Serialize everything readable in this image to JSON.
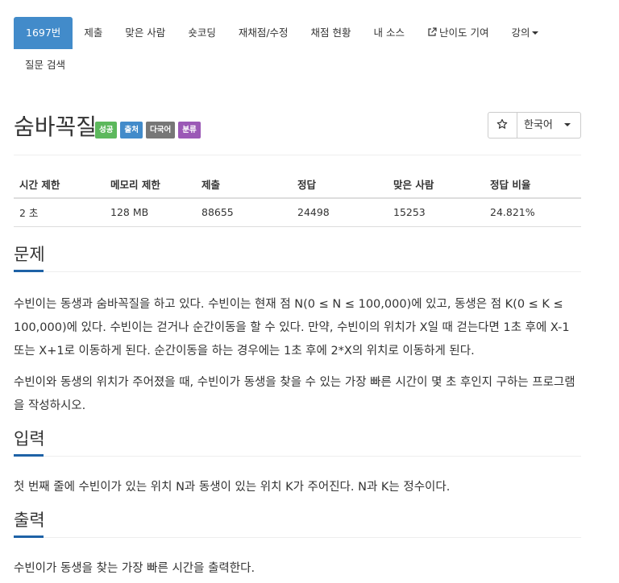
{
  "nav": {
    "tabs": [
      {
        "label": "1697번",
        "active": true
      },
      {
        "label": "제출"
      },
      {
        "label": "맞은 사람"
      },
      {
        "label": "숏코딩"
      },
      {
        "label": "재채점/수정"
      },
      {
        "label": "채점 현황"
      },
      {
        "label": "내 소스"
      },
      {
        "label": "난이도 기여",
        "icon": "external-link-icon"
      },
      {
        "label": "강의",
        "dropdown": true
      }
    ],
    "row2": [
      {
        "label": "질문 검색"
      }
    ]
  },
  "problem": {
    "title": "숨바꼭질",
    "labels": [
      {
        "text": "성공",
        "color": "#5cb85c"
      },
      {
        "text": "출처",
        "color": "#428bca"
      },
      {
        "text": "다국어",
        "color": "#777777"
      },
      {
        "text": "분류",
        "color": "#9b59b6"
      }
    ],
    "language": "한국어",
    "star_icon": "star-outline-icon"
  },
  "info": {
    "headers": [
      "시간 제한",
      "메모리 제한",
      "제출",
      "정답",
      "맞은 사람",
      "정답 비율"
    ],
    "values": [
      "2 초",
      "128 MB",
      "88655",
      "24498",
      "15253",
      "24.821%"
    ]
  },
  "sections": {
    "description": {
      "heading": "문제",
      "paragraphs": [
        "수빈이는 동생과 숨바꼭질을 하고 있다. 수빈이는 현재 점 N(0 ≤ N ≤ 100,000)에 있고, 동생은 점 K(0 ≤ K ≤ 100,000)에 있다. 수빈이는 걷거나 순간이동을 할 수 있다. 만약, 수빈이의 위치가 X일 때 걷는다면 1초 후에 X-1 또는 X+1로 이동하게 된다. 순간이동을 하는 경우에는 1초 후에 2*X의 위치로 이동하게 된다.",
        "수빈이와 동생의 위치가 주어졌을 때, 수빈이가 동생을 찾을 수 있는 가장 빠른 시간이 몇 초 후인지 구하는 프로그램을 작성하시오."
      ]
    },
    "input": {
      "heading": "입력",
      "text": "첫 번째 줄에 수빈이가 있는 위치 N과 동생이 있는 위치 K가 주어진다. N과 K는 정수이다."
    },
    "output": {
      "heading": "출력",
      "text": "수빈이가 동생을 찾는 가장 빠른 시간을 출력한다."
    }
  }
}
